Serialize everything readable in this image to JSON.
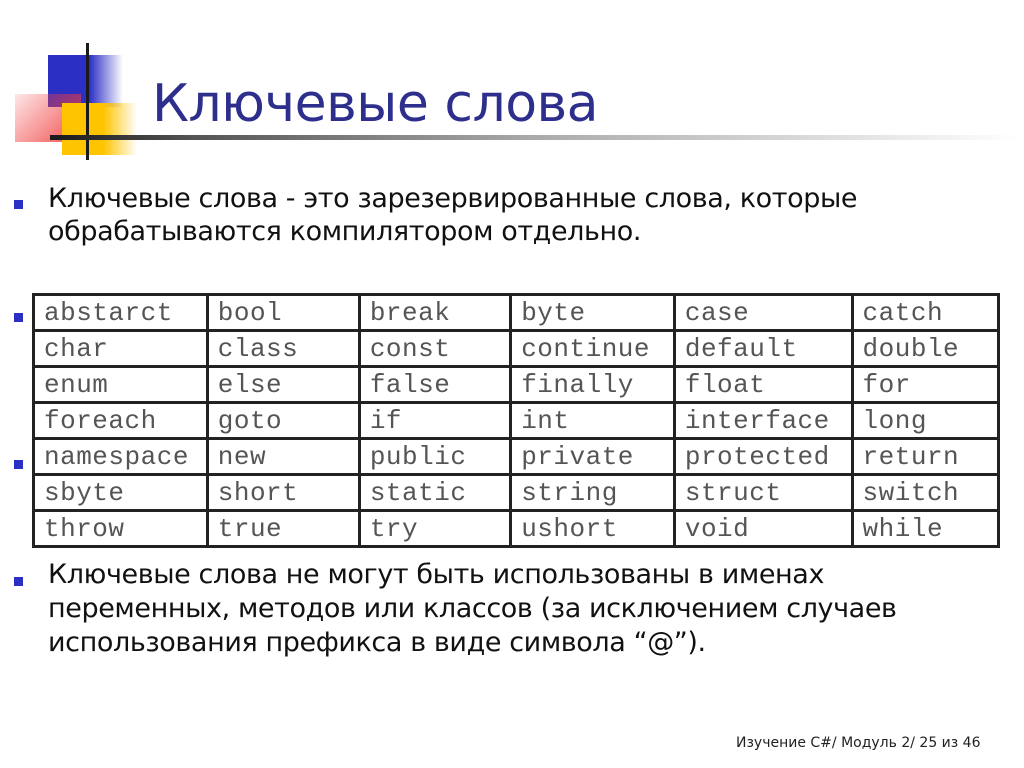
{
  "slide": {
    "title": "Ключевые слова",
    "bullets": [
      {
        "lines": [
          "Ключевые слова - это зарезервированные слова, которые",
          "обрабатываются компилятором отдельно."
        ]
      },
      {
        "lines": [
          "Ключевые слова не могут быть использованы в именах",
          "переменных, методов или классов (за исключением случаев",
          "использования префикса в виде символа “@”)."
        ]
      }
    ],
    "keywords_table": [
      [
        "abstarct",
        "bool",
        "break",
        "byte",
        "case",
        "catch"
      ],
      [
        "char",
        "class",
        "const",
        "continue",
        "default",
        "double"
      ],
      [
        "enum",
        "else",
        "false",
        "finally",
        "float",
        "for"
      ],
      [
        "foreach",
        "goto",
        "if",
        "int",
        "interface",
        "long"
      ],
      [
        "namespace",
        "new",
        "public",
        "private",
        "protected",
        "return"
      ],
      [
        "sbyte",
        "short",
        "static",
        "string",
        "struct",
        "switch"
      ],
      [
        "throw",
        "true",
        "try",
        "ushort",
        "void",
        "while"
      ]
    ],
    "footer": "Изучение C#/ Модуль 2/ 25 из 46"
  },
  "colors": {
    "title": "#2e2e8c",
    "bullet": "#2b2fc4"
  }
}
